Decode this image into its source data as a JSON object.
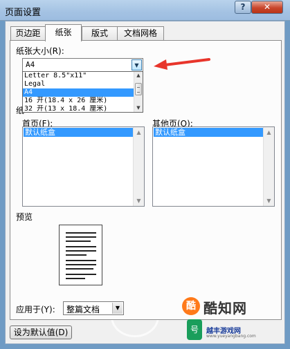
{
  "window": {
    "title": "页面设置",
    "help_label": "?",
    "close_label": "✕"
  },
  "tabs": [
    {
      "label": "页边距"
    },
    {
      "label": "纸张"
    },
    {
      "label": "版式"
    },
    {
      "label": "文档网格"
    }
  ],
  "paper_size": {
    "label": "纸张大小(R):",
    "value": "A4",
    "options": [
      "Letter 8.5\"x11\"",
      "Legal",
      "A4",
      "16 开(18.4 x 26 厘米)",
      "32 开(13 x 18.4 厘米)"
    ],
    "selected_index": 2
  },
  "paper_source": {
    "label_partial": "纸",
    "first_page": {
      "label": "首页(F):",
      "items": [
        "默认纸盒"
      ]
    },
    "other_pages": {
      "label": "其他页(O):",
      "items": [
        "默认纸盒"
      ]
    }
  },
  "preview": {
    "label": "预览"
  },
  "apply_to": {
    "label": "应用于(Y):",
    "value": "整篇文档"
  },
  "default_button": {
    "label": "设为默认值(D)"
  },
  "watermark": {
    "logo_char": "酷",
    "title": "酷知网",
    "green_char": "号",
    "subtitle": "越丰游戏网",
    "url": "www.yueyangbang.com"
  },
  "icons": {
    "dropdown_arrow": "chevron-down-icon",
    "scroll_up": "scroll-up-icon",
    "scroll_down": "scroll-down-icon",
    "annotation": "red-arrow-icon"
  },
  "colors": {
    "selection": "#3399ff",
    "annotation_arrow": "#e8352b",
    "titlebar": "#a4c2e3"
  }
}
